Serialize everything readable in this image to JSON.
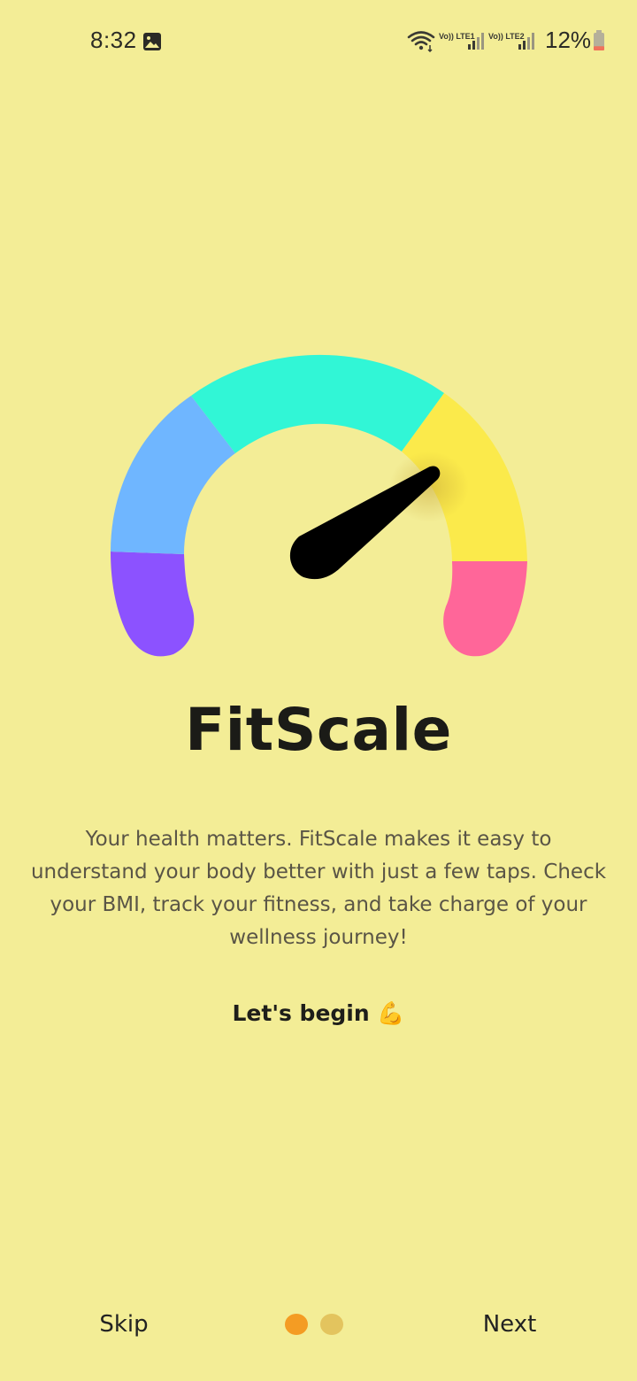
{
  "status_bar": {
    "time": "8:32",
    "lte1": "Vo)) LTE1",
    "lte2": "Vo)) LTE2",
    "battery_percent": "12%",
    "battery_level": 0.12
  },
  "gauge": {
    "segment_colors": [
      "#8C52FF",
      "#6FB6FF",
      "#31F6D6",
      "#FBEA4B",
      "#FF6699"
    ],
    "needle_color": "#000000"
  },
  "onboarding": {
    "title": "FitScale",
    "description": "Your health matters. FitScale makes it easy to understand your body better with just a few taps. Check your BMI, track your fitness, and take charge of your wellness journey!",
    "cta": "Let's begin 💪"
  },
  "navigation": {
    "skip_label": "Skip",
    "next_label": "Next",
    "page_count": 2,
    "active_page": 1
  },
  "colors": {
    "background": "#F3ED96",
    "active_dot": "#F49C23",
    "inactive_dot": "#E3C45E"
  }
}
